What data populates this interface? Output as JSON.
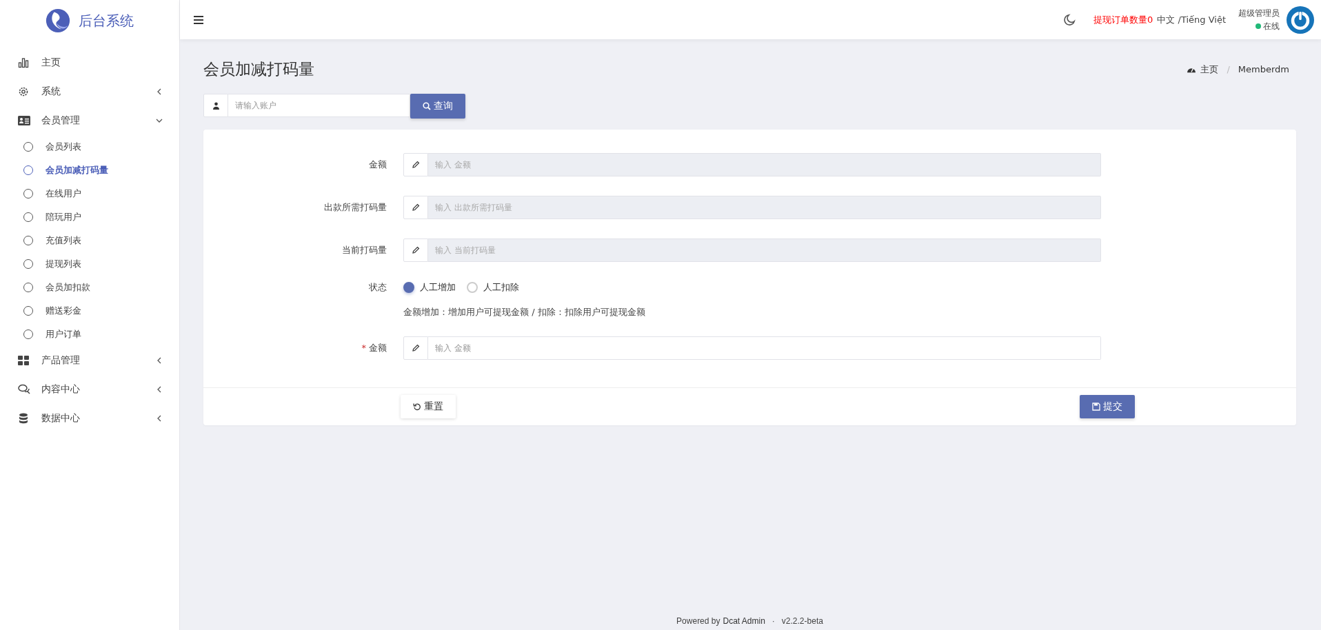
{
  "brand": {
    "title": "后台系统"
  },
  "sidebar": {
    "items": [
      {
        "label": "主页"
      },
      {
        "label": "系统",
        "has_caret": true,
        "expanded": false
      },
      {
        "label": "会员管理",
        "has_caret": true,
        "expanded": true,
        "children": [
          {
            "label": "会员列表",
            "selected": false
          },
          {
            "label": "会员加减打码量",
            "selected": true
          },
          {
            "label": "在线用户",
            "selected": false
          },
          {
            "label": "陪玩用户",
            "selected": false
          },
          {
            "label": "充值列表",
            "selected": false
          },
          {
            "label": "提现列表",
            "selected": false
          },
          {
            "label": "会员加扣款",
            "selected": false
          },
          {
            "label": "赠送彩金",
            "selected": false
          },
          {
            "label": "用户订单",
            "selected": false
          }
        ]
      },
      {
        "label": "产品管理",
        "has_caret": true,
        "expanded": false
      },
      {
        "label": "内容中心",
        "has_caret": true,
        "expanded": false
      },
      {
        "label": "数据中心",
        "has_caret": true,
        "expanded": false
      }
    ]
  },
  "topbar": {
    "notice": "提现订单数量0",
    "language": "中文 /Tiếng Việt",
    "user": {
      "name": "超级管理员",
      "status": "在线",
      "online": true
    }
  },
  "page": {
    "title": "会员加减打码量",
    "breadcrumb": {
      "items": [
        "主页",
        "Memberdm"
      ],
      "separator": "/"
    }
  },
  "search": {
    "placeholder": "请输入账户",
    "button": "查询"
  },
  "form": {
    "fields": [
      {
        "kind": "input",
        "label": "金额",
        "placeholder": "输入 金额",
        "disabled": true
      },
      {
        "kind": "input",
        "label": "出款所需打码量",
        "placeholder": "输入 出款所需打码量",
        "disabled": true
      },
      {
        "kind": "input",
        "label": "当前打码量",
        "placeholder": "输入 当前打码量",
        "disabled": true
      },
      {
        "kind": "radio",
        "label": "状态",
        "options": [
          {
            "label": "人工增加",
            "selected": true
          },
          {
            "label": "人工扣除",
            "selected": false
          }
        ],
        "help": "金额增加：增加用户可提现金额 / 扣除：扣除用户可提现金额"
      },
      {
        "kind": "input",
        "label": "金额",
        "placeholder": "输入 金额",
        "disabled": false,
        "required_mark": "*"
      }
    ],
    "reset": "重置",
    "submit": "提交"
  },
  "footer": {
    "text": "Powered by",
    "link": "Dcat Admin",
    "separator": "·",
    "version": "v2.2.2-beta"
  }
}
